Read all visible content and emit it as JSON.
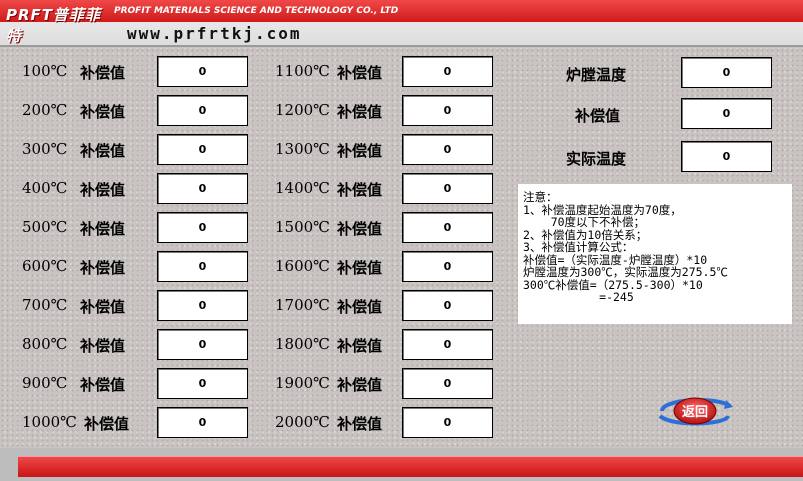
{
  "header": {
    "logo_text": "PRFT普菲菲特",
    "company": "PROFIT MATERIALS SCIENCE AND TECHNOLOGY CO., LTD",
    "url": "www.prfrtkj.com"
  },
  "left_column": [
    {
      "temp": "100℃",
      "label": "补偿值",
      "value": "0"
    },
    {
      "temp": "200℃",
      "label": "补偿值",
      "value": "0"
    },
    {
      "temp": "300℃",
      "label": "补偿值",
      "value": "0"
    },
    {
      "temp": "400℃",
      "label": "补偿值",
      "value": "0"
    },
    {
      "temp": "500℃",
      "label": "补偿值",
      "value": "0"
    },
    {
      "temp": "600℃",
      "label": "补偿值",
      "value": "0"
    },
    {
      "temp": "700℃",
      "label": "补偿值",
      "value": "0"
    },
    {
      "temp": "800℃",
      "label": "补偿值",
      "value": "0"
    },
    {
      "temp": "900℃",
      "label": "补偿值",
      "value": "0"
    },
    {
      "temp": "1000℃",
      "label": "补偿值",
      "value": "0"
    }
  ],
  "middle_column": [
    {
      "temp": "1100℃",
      "label": "补偿值",
      "value": "0"
    },
    {
      "temp": "1200℃",
      "label": "补偿值",
      "value": "0"
    },
    {
      "temp": "1300℃",
      "label": "补偿值",
      "value": "0"
    },
    {
      "temp": "1400℃",
      "label": "补偿值",
      "value": "0"
    },
    {
      "temp": "1500℃",
      "label": "补偿值",
      "value": "0"
    },
    {
      "temp": "1600℃",
      "label": "补偿值",
      "value": "0"
    },
    {
      "temp": "1700℃",
      "label": "补偿值",
      "value": "0"
    },
    {
      "temp": "1800℃",
      "label": "补偿值",
      "value": "0"
    },
    {
      "temp": "1900℃",
      "label": "补偿值",
      "value": "0"
    },
    {
      "temp": "2000℃",
      "label": "补偿值",
      "value": "0"
    }
  ],
  "readouts": [
    {
      "label": "炉膛温度",
      "value": "0"
    },
    {
      "label": "补偿值",
      "value": "0"
    },
    {
      "label": "实际温度",
      "value": "0"
    }
  ],
  "note": {
    "lines": [
      "注意：",
      "1、补偿温度起始温度为70度，",
      "    70度以下不补偿；",
      "2、补偿值为10倍关系；",
      "3、补偿值计算公式：",
      "补偿值=（实际温度-炉膛温度）*10",
      "炉膛温度为300℃，实际温度为275.5℃",
      "300℃补偿值=（275.5-300）*10",
      "           =-245"
    ]
  },
  "back_button": {
    "label": "返回"
  },
  "colors": {
    "header_red": "#e33232",
    "footer_red": "#e02828",
    "background": "#c9c4c2"
  }
}
